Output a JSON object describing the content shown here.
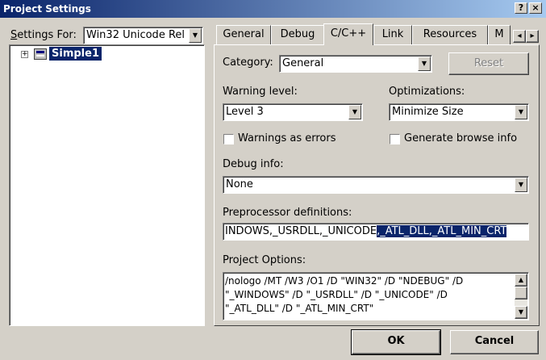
{
  "window": {
    "title": "Project Settings",
    "help_btn": "?",
    "close_btn": "×"
  },
  "left": {
    "settings_for_label": "Settings For:",
    "settings_for_value": "Win32 Unicode Rel",
    "tree": [
      {
        "label": "Simple1",
        "expander": "+",
        "selected": true
      }
    ]
  },
  "tabs": [
    {
      "label": "General"
    },
    {
      "label": "Debug"
    },
    {
      "label": "C/C++",
      "active": true
    },
    {
      "label": "Link"
    },
    {
      "label": "Resources"
    },
    {
      "label": "M"
    }
  ],
  "tab_scroll": {
    "left": "◂",
    "right": "▸"
  },
  "cpp": {
    "category_label": "Category:",
    "category_value": "General",
    "reset_label": "Reset",
    "warning_level_label": "Warning level:",
    "warning_level_value": "Level 3",
    "optimizations_label": "Optimizations:",
    "optimizations_value": "Minimize Size",
    "warnings_as_errors_label": "Warnings as errors",
    "warnings_as_errors_checked": false,
    "generate_browse_info_label": "Generate browse info",
    "generate_browse_info_checked": false,
    "debug_info_label": "Debug info:",
    "debug_info_value": "None",
    "preprocessor_label": "Preprocessor definitions:",
    "preprocessor_plain": "INDOWS,_USRDLL,_UNICODE",
    "preprocessor_selected": ",_ATL_DLL,_ATL_MIN_CRT",
    "project_options_label": "Project Options:",
    "project_options_lines": [
      "/nologo /MT /W3 /O1 /D \"WIN32\" /D \"NDEBUG\" /D",
      "\"_WINDOWS\" /D \"_USRDLL\" /D \"_UNICODE\" /D",
      "\"_ATL_DLL\" /D \"_ATL_MIN_CRT\""
    ]
  },
  "footer": {
    "ok_label": "OK",
    "cancel_label": "Cancel"
  },
  "glyphs": {
    "down_arrow": "▼",
    "up_arrow": "▲"
  }
}
